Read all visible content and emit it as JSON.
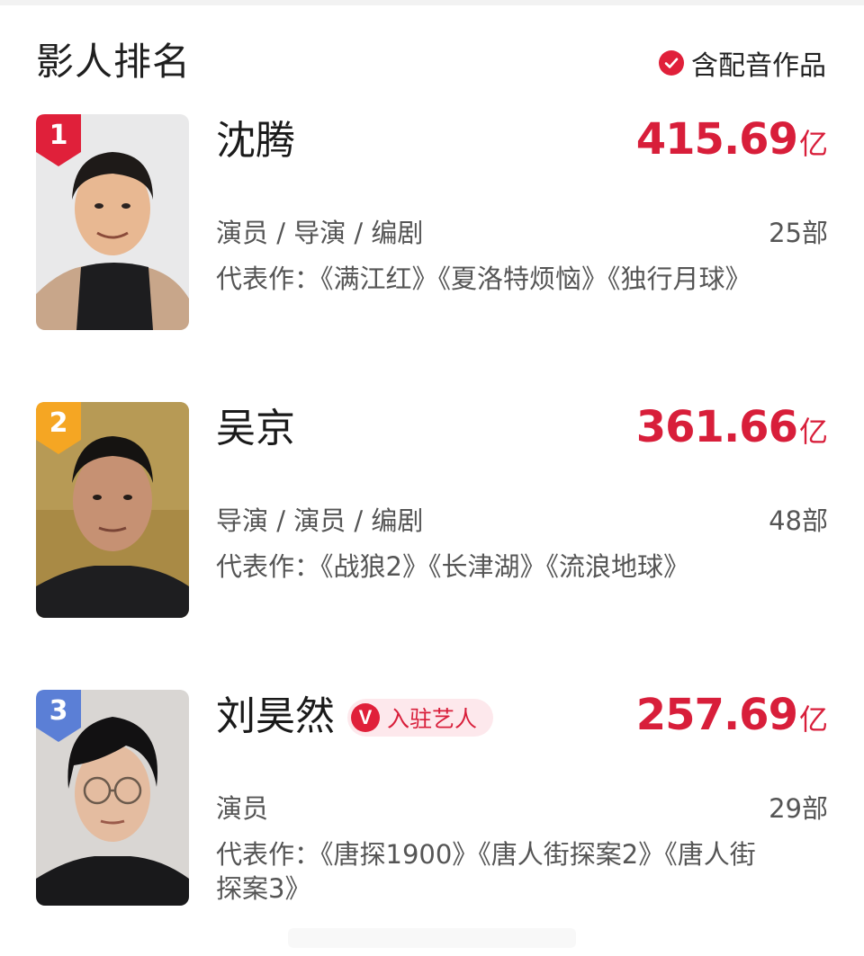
{
  "header": {
    "title": "影人排名",
    "toggle_label": "含配音作品",
    "toggle_checked": true
  },
  "accent_color": "#d81e3a",
  "rank_badge_colors": [
    "#e0203a",
    "#f5a623",
    "#5b7fd6"
  ],
  "items": [
    {
      "rank": "1",
      "name": "沈腾",
      "box_office_value": "415.69",
      "box_office_unit": "亿",
      "roles": "演员 / 导演 / 编剧",
      "count": "25部",
      "works": "代表作：《满江红》《夏洛特烦恼》《独行月球》",
      "photo_icon": "person-photo"
    },
    {
      "rank": "2",
      "name": "吴京",
      "box_office_value": "361.66",
      "box_office_unit": "亿",
      "roles": "导演 / 演员 / 编剧",
      "count": "48部",
      "works": "代表作：《战狼2》《长津湖》《流浪地球》",
      "photo_icon": "person-photo"
    },
    {
      "rank": "3",
      "name": "刘昊然",
      "artist_tag": "入驻艺人",
      "artist_tag_icon": "v-verified-icon",
      "box_office_value": "257.69",
      "box_office_unit": "亿",
      "roles": "演员",
      "count": "29部",
      "works": "代表作：《唐探1900》《唐人街探案2》《唐人街探案3》",
      "photo_icon": "person-photo"
    }
  ]
}
